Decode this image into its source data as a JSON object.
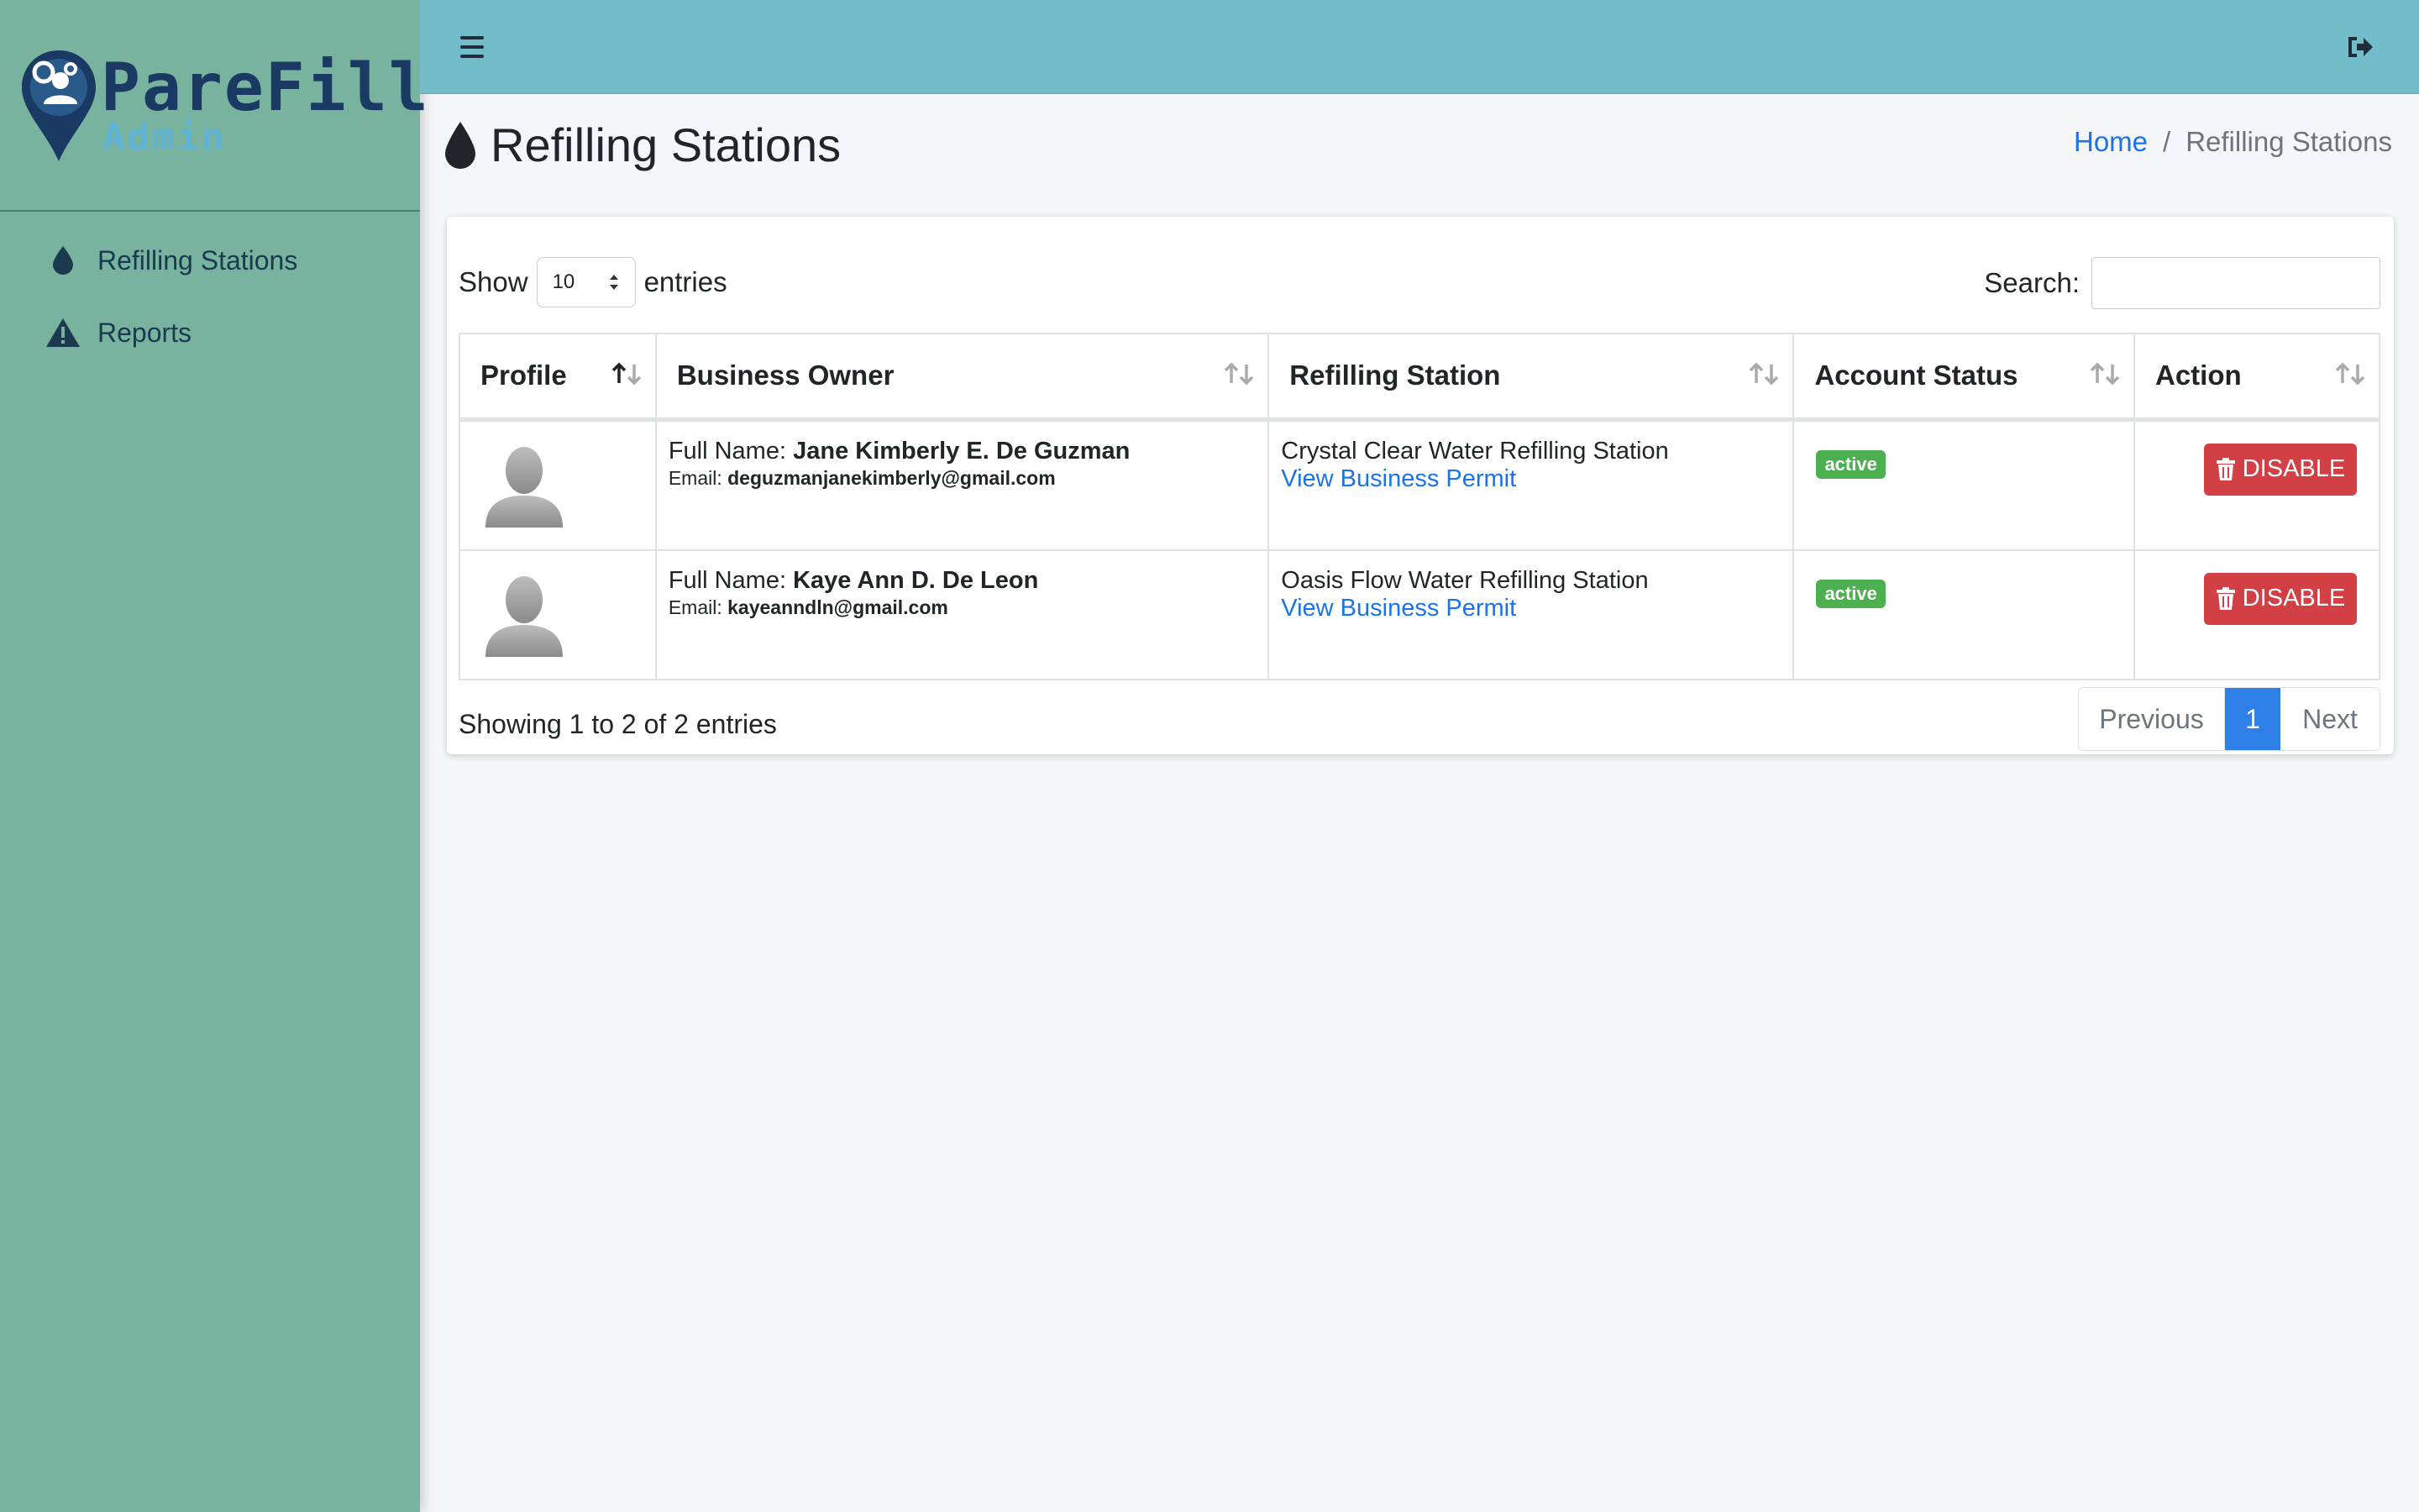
{
  "brand": {
    "name": "PareFill",
    "subtitle": "Admin"
  },
  "sidebar": {
    "items": [
      {
        "label": "Refilling Stations",
        "icon": "droplet-icon"
      },
      {
        "label": "Reports",
        "icon": "warning-icon"
      }
    ]
  },
  "topbar": {
    "menu_icon": "hamburger-icon",
    "logout_icon": "sign-out-icon"
  },
  "page": {
    "title": "Refilling Stations",
    "title_icon": "droplet-icon"
  },
  "breadcrumb": {
    "home": "Home",
    "separator": "/",
    "current": "Refilling Stations"
  },
  "table_controls": {
    "show_label": "Show",
    "entries_label": "entries",
    "length_value": "10",
    "search_label": "Search:",
    "search_value": ""
  },
  "table": {
    "headers": [
      "Profile",
      "Business Owner",
      "Refilling Station",
      "Account Status",
      "Action"
    ],
    "rows": [
      {
        "full_name_label": "Full Name:",
        "full_name": "Jane Kimberly E. De Guzman",
        "email_label": "Email:",
        "email": "deguzmanjanekimberly@gmail.com",
        "station": "Crystal Clear Water Refilling Station",
        "permit_link": "View Business Permit",
        "status": "active",
        "action": "DISABLE"
      },
      {
        "full_name_label": "Full Name:",
        "full_name": "Kaye Ann D. De Leon",
        "email_label": "Email:",
        "email": "kayeanndln@gmail.com",
        "station": "Oasis Flow Water Refilling Station",
        "permit_link": "View Business Permit",
        "status": "active",
        "action": "DISABLE"
      }
    ]
  },
  "footer": {
    "info": "Showing 1 to 2 of 2 entries",
    "prev": "Previous",
    "page": "1",
    "next": "Next"
  },
  "colors": {
    "sidebar_bg": "#78b39f",
    "topbar_bg": "#73bcc9",
    "link": "#1a73e8",
    "badge_active": "#4caf50",
    "danger": "#d23f45",
    "page_active": "#2f7fe8"
  }
}
